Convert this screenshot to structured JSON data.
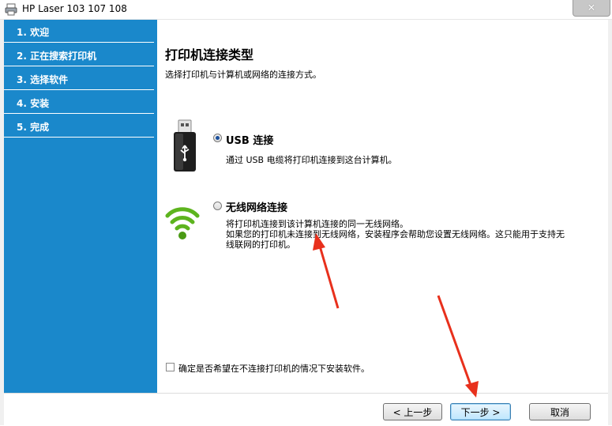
{
  "window": {
    "title": "HP Laser 103 107 108",
    "close_glyph": "✕"
  },
  "sidebar": {
    "steps": [
      {
        "label": "1. 欢迎"
      },
      {
        "label": "2. 正在搜索打印机"
      },
      {
        "label": "3. 选择软件"
      },
      {
        "label": "4. 安装"
      },
      {
        "label": "5. 完成"
      }
    ],
    "color": "#1a88cb"
  },
  "main": {
    "title": "打印机连接类型",
    "subtitle": "选择打印机与计算机或网络的连接方式。",
    "options": {
      "usb": {
        "title": "USB 连接",
        "description": "通过 USB 电缆将打印机连接到这台计算机。",
        "selected": true,
        "icon": "usb-drive-icon"
      },
      "wireless": {
        "title": "无线网络连接",
        "description_line1": "将打印机连接到该计算机连接的同一无线网络。",
        "description_line2": "如果您的打印机未连接到无线网络，安装程序会帮助您设置无线网络。这只能用于支持无",
        "description_line3": "线联网的打印机。",
        "selected": false,
        "icon": "wifi-signal-icon"
      }
    },
    "no_printer_checkbox": {
      "label": "确定是否希望在不连接打印机的情况下安装软件。",
      "checked": false
    }
  },
  "footer": {
    "back_label": "< 上一步",
    "next_label": "下一步 >",
    "cancel_label": "取消"
  },
  "annotations": {
    "arrow_color": "#e8301c"
  }
}
